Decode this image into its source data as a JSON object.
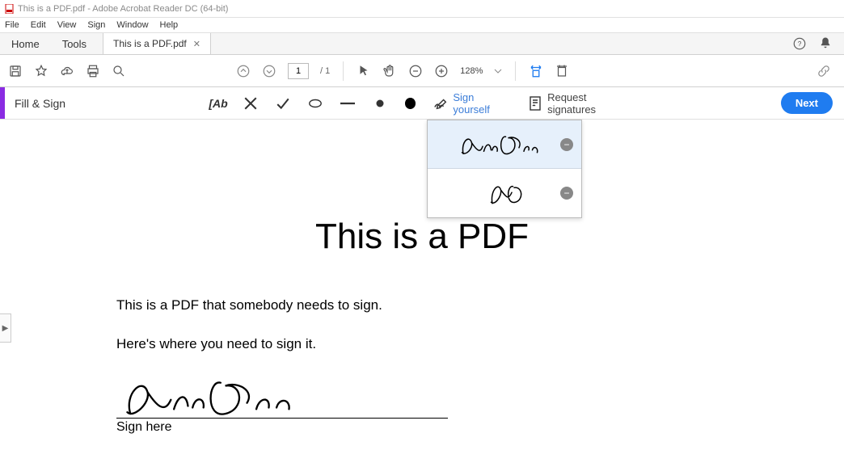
{
  "window": {
    "title": "This is a PDF.pdf - Adobe Acrobat Reader DC (64-bit)"
  },
  "menus": {
    "file": "File",
    "edit": "Edit",
    "view": "View",
    "sign": "Sign",
    "window": "Window",
    "help": "Help"
  },
  "tabs": {
    "home": "Home",
    "tools": "Tools",
    "doc": "This is a PDF.pdf"
  },
  "toolbar": {
    "page_current": "1",
    "page_total": "/  1",
    "zoom": "128%"
  },
  "fillsign": {
    "title": "Fill & Sign",
    "sign_yourself": "Sign yourself",
    "request": "Request signatures",
    "next": "Next"
  },
  "signatures": {
    "full_name": "Jane Doe",
    "initials": "JD"
  },
  "document": {
    "title": "This is a PDF",
    "p1": "This is a PDF that somebody needs to sign.",
    "p2": "Here's where you need to sign it.",
    "sign_here": "Sign here"
  }
}
